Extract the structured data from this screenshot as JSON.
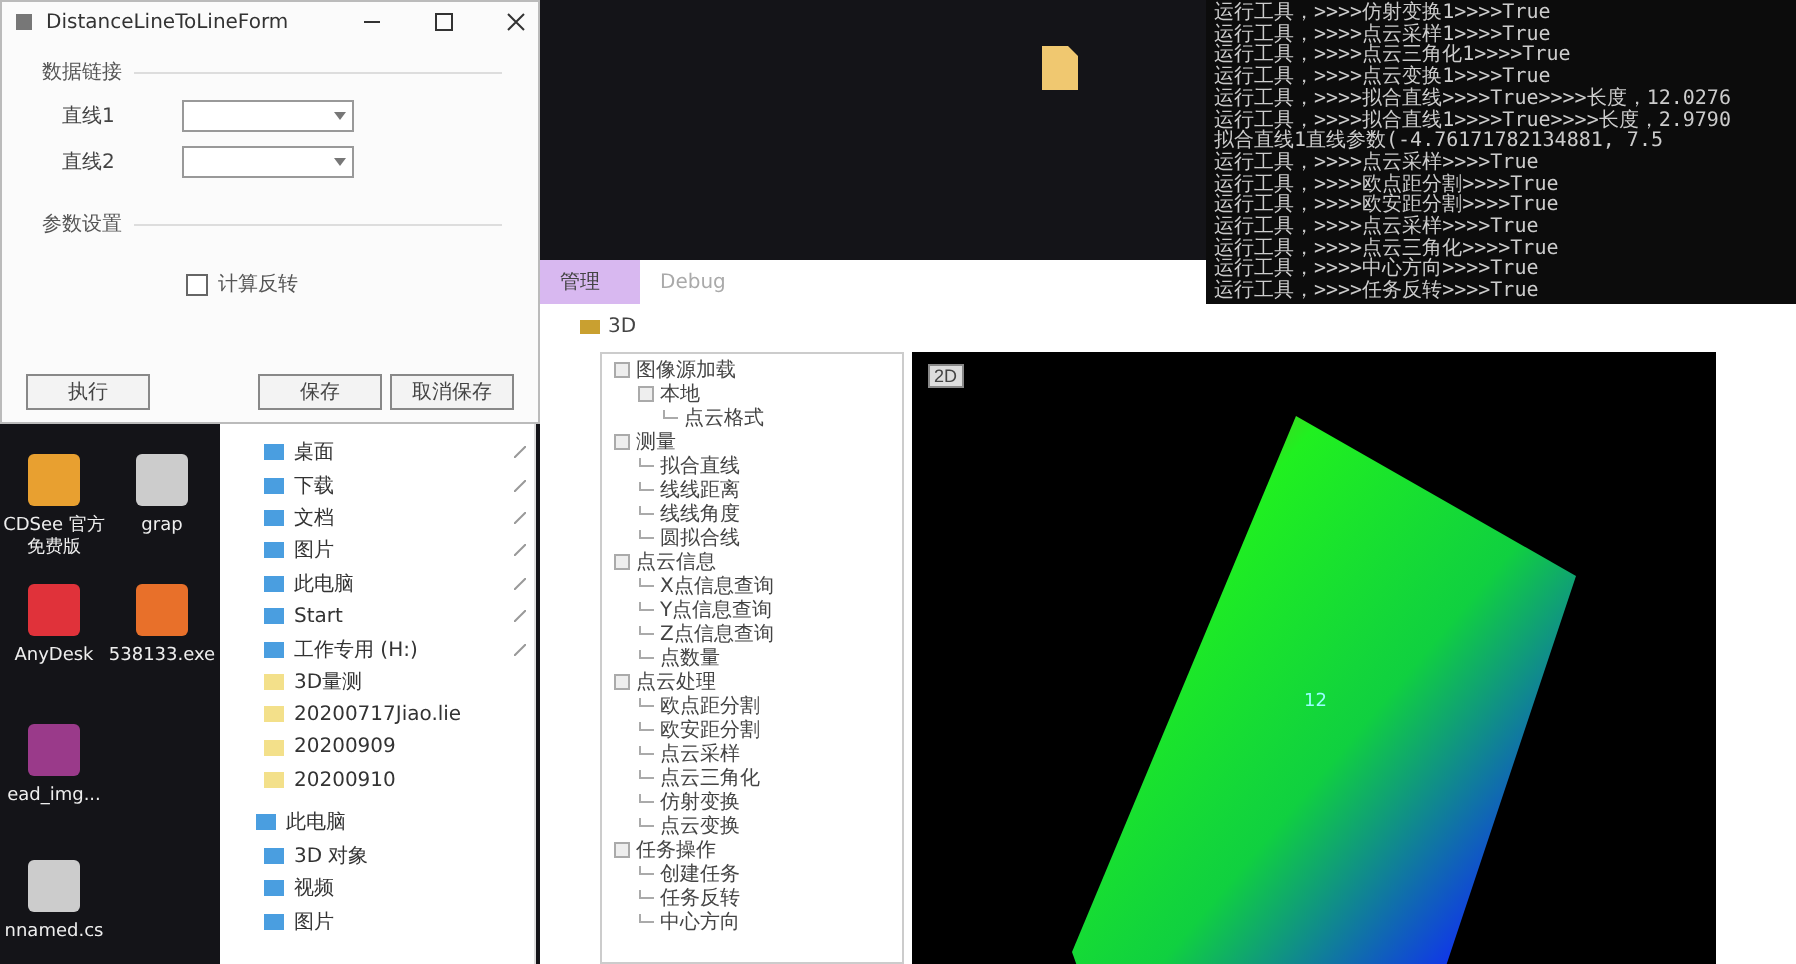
{
  "dialog": {
    "title": "DistanceLineToLineForm",
    "group_1": "数据链接",
    "fields": [
      {
        "label": "直线1"
      },
      {
        "label": "直线2"
      }
    ],
    "group_2": "参数设置",
    "checkbox": {
      "label": "计算反转",
      "checked": false
    },
    "buttons": [
      "执行",
      "保存",
      "取消保存"
    ]
  },
  "desktop_icons": [
    {
      "label": "CDSee 官方免费版",
      "kind": "eye"
    },
    {
      "label": "grap",
      "kind": "doc"
    },
    {
      "label": "AnyDesk",
      "kind": "red"
    },
    {
      "label": "538133.exe",
      "kind": "orange"
    },
    {
      "label": "ead_img...",
      "kind": "archive"
    },
    {
      "label": "nnamed.cs",
      "kind": "doc"
    }
  ],
  "console_lines": [
    "运行工具，>>>>仿射变换1>>>>True",
    "运行工具，>>>>点云采样1>>>>True",
    "运行工具，>>>>点云三角化1>>>>True",
    "运行工具，>>>>点云变换1>>>>True",
    "运行工具，>>>>拟合直线>>>>True>>>>长度，12.0276",
    "运行工具，>>>>拟合直线1>>>>True>>>>长度，2.9790",
    "拟合直线1直线参数(-4.76171782134881, 7.5",
    "运行工具，>>>>点云采样>>>>True",
    "运行工具，>>>>欧点距分割>>>>True",
    "运行工具，>>>>欧安距分割>>>>True",
    "运行工具，>>>>点云采样>>>>True",
    "运行工具，>>>>点云三角化>>>>True",
    "运行工具，>>>>中心方向>>>>True",
    "运行工具，>>>>任务反转>>>>True"
  ],
  "tabs": [
    {
      "label": "管理",
      "selected": true
    },
    {
      "label": "Debug",
      "selected": false
    }
  ],
  "explorer_items": [
    {
      "label": "桌面",
      "kind": "pinned"
    },
    {
      "label": "下载",
      "kind": "pinned"
    },
    {
      "label": "文档",
      "kind": "pinned"
    },
    {
      "label": "图片",
      "kind": "pinned"
    },
    {
      "label": "此电脑",
      "kind": "pinned"
    },
    {
      "label": "Start",
      "kind": "pinned"
    },
    {
      "label": "工作专用 (H:)",
      "kind": "pinned"
    },
    {
      "label": "3D量测",
      "kind": "folder"
    },
    {
      "label": "20200717Jiao.lie",
      "kind": "folder"
    },
    {
      "label": "20200909",
      "kind": "folder"
    },
    {
      "label": "20200910",
      "kind": "folder"
    },
    {
      "label": "此电脑",
      "kind": "root"
    },
    {
      "label": "3D 对象",
      "kind": "item"
    },
    {
      "label": "视频",
      "kind": "item"
    },
    {
      "label": "图片",
      "kind": "item"
    }
  ],
  "app": {
    "title": "3D",
    "tree": [
      {
        "label": "图像源加载",
        "expanded": true,
        "children": [
          {
            "label": "本地",
            "expanded": true,
            "children": [
              {
                "label": "点云格式"
              }
            ]
          }
        ]
      },
      {
        "label": "测量",
        "expanded": true,
        "children": [
          {
            "label": "拟合直线"
          },
          {
            "label": "线线距离"
          },
          {
            "label": "线线角度"
          },
          {
            "label": "圆拟合线"
          }
        ]
      },
      {
        "label": "点云信息",
        "expanded": true,
        "children": [
          {
            "label": "X点信息查询"
          },
          {
            "label": "Y点信息查询"
          },
          {
            "label": "Z点信息查询"
          },
          {
            "label": "点数量"
          }
        ]
      },
      {
        "label": "点云处理",
        "expanded": true,
        "children": [
          {
            "label": "欧点距分割"
          },
          {
            "label": "欧安距分割"
          },
          {
            "label": "点云采样"
          },
          {
            "label": "点云三角化"
          },
          {
            "label": "仿射变换"
          },
          {
            "label": "点云变换"
          }
        ]
      },
      {
        "label": "任务操作",
        "expanded": true,
        "children": [
          {
            "label": "创建任务"
          },
          {
            "label": "任务反转"
          },
          {
            "label": "中心方向"
          }
        ]
      }
    ],
    "viewer": {
      "mode_button": "2D",
      "point_label": "12"
    }
  }
}
